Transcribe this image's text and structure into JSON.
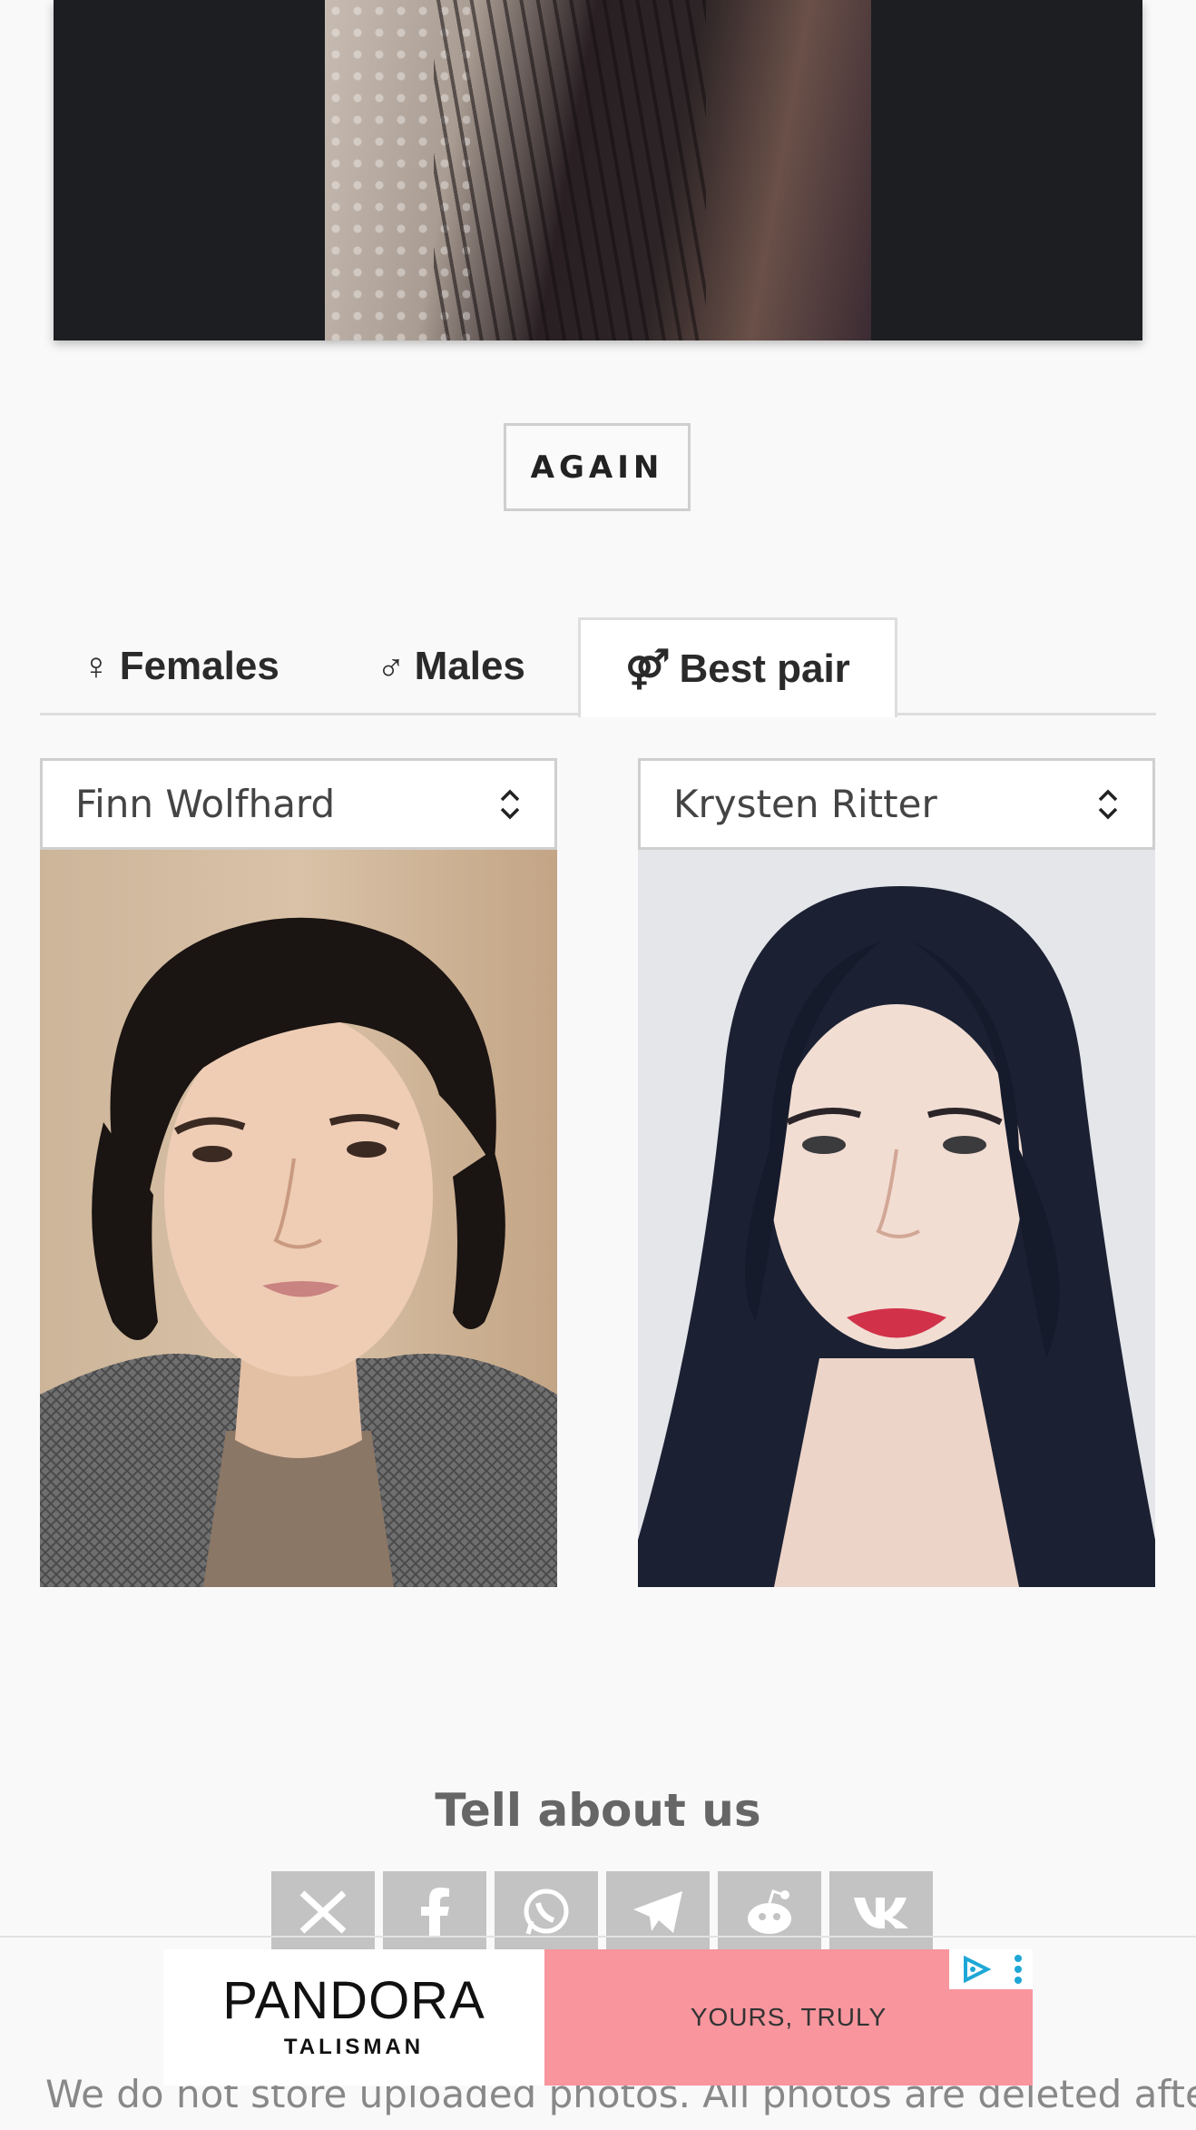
{
  "again_button": "AGAIN",
  "tabs": [
    {
      "icon": "female-icon",
      "glyph": "♀",
      "label": "Females"
    },
    {
      "icon": "male-icon",
      "glyph": "♂",
      "label": "Males"
    },
    {
      "icon": "pair-icon",
      "glyph": "⚤",
      "label": "Best pair"
    }
  ],
  "pair": {
    "left_select": "Finn Wolfhard",
    "right_select": "Krysten Ritter"
  },
  "share": {
    "heading": "Tell about us",
    "icons": [
      "x-icon",
      "facebook-icon",
      "whatsapp-icon",
      "telegram-icon",
      "reddit-icon",
      "vk-icon"
    ]
  },
  "ad": {
    "brand": "PANDORA",
    "brand_sub": "TALISMAN",
    "tagline": "YOURS, TRULY"
  },
  "disclaimer": "We do not store uploaded photos. All photos are deleted after",
  "colors": {
    "background": "#f9f9f9",
    "share_button": "#c3c3c3",
    "ad_pink": "#f8959d"
  }
}
